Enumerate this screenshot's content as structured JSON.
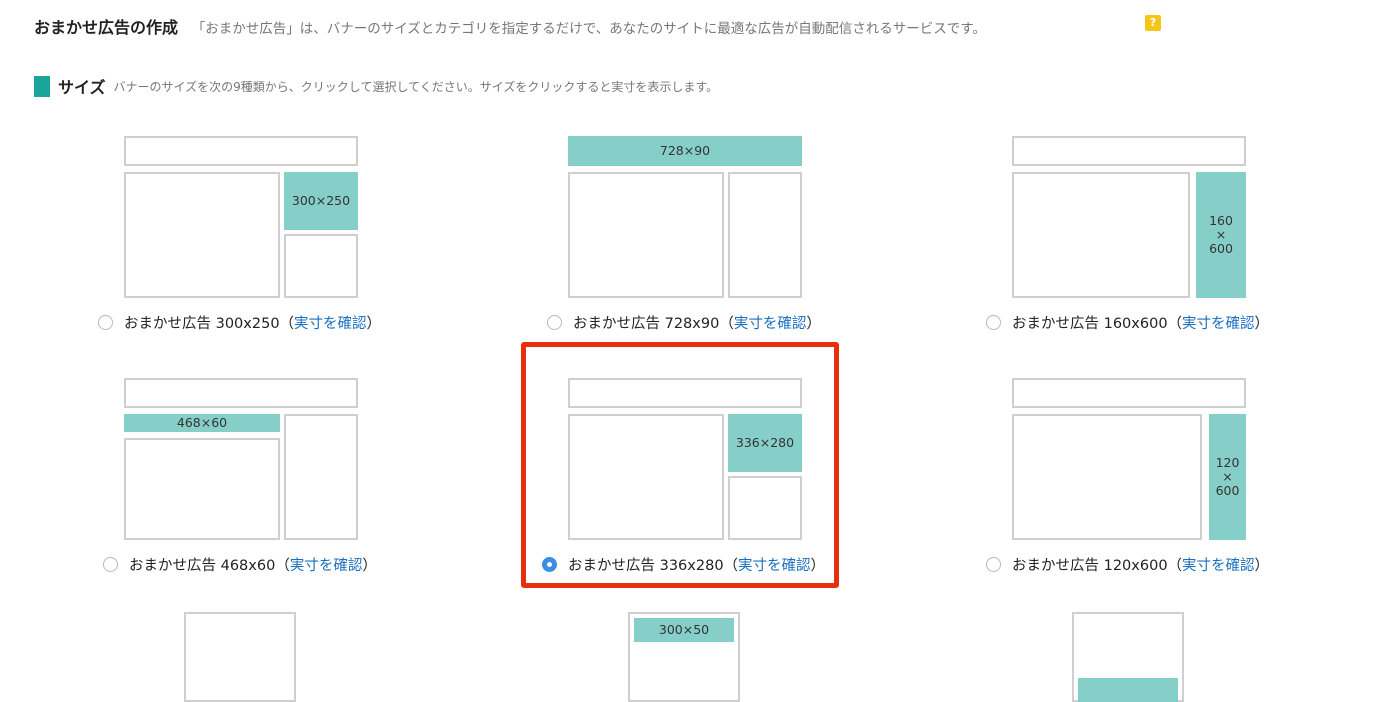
{
  "header": {
    "title": "おまかせ広告の作成",
    "description": "「おまかせ広告」は、バナーのサイズとカテゴリを指定するだけで、あなたのサイトに最適な広告が自動配信されるサービスです。",
    "help_glyph": "?"
  },
  "size_section": {
    "label": "サイズ",
    "hint": "バナーのサイズを次の9種類から、クリックして選択してください。サイズをクリックすると実寸を表示します。"
  },
  "options": [
    {
      "ad_label": "300×250",
      "text": "おまかせ広告 300x250",
      "link": "実寸を確認",
      "selected": false
    },
    {
      "ad_label": "728×90",
      "text": "おまかせ広告 728x90",
      "link": "実寸を確認",
      "selected": false
    },
    {
      "ad_label": "160\n×\n600",
      "text": "おまかせ広告 160x600",
      "link": "実寸を確認",
      "selected": false
    },
    {
      "ad_label": "468×60",
      "text": "おまかせ広告 468x60",
      "link": "実寸を確認",
      "selected": false
    },
    {
      "ad_label": "336×280",
      "text": "おまかせ広告 336x280",
      "link": "実寸を確認",
      "selected": true
    },
    {
      "ad_label": "120\n×\n600",
      "text": "おまかせ広告 120x600",
      "link": "実寸を確認",
      "selected": false
    },
    {
      "ad_label": "",
      "text": "",
      "link": "",
      "selected": false
    },
    {
      "ad_label": "300×50",
      "text": "",
      "link": "",
      "selected": false
    },
    {
      "ad_label": "",
      "text": "",
      "link": "",
      "selected": false
    }
  ],
  "colors": {
    "ad_fill": "#86cfc9",
    "highlight": "#e8300f",
    "radio_selected": "#3a8ee6",
    "link": "#1a6fc2"
  }
}
